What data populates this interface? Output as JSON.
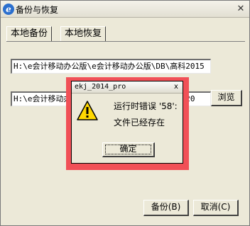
{
  "window": {
    "title": "备份与恢复",
    "app_icon": "e-logo-icon",
    "close_symbol": "✕"
  },
  "tabs": [
    {
      "label": "本地备份",
      "active": true
    },
    {
      "label": "本地恢复",
      "active": false
    }
  ],
  "backup_path": {
    "value": "H:\\e会计移动办公版\\e会计移动办公版\\DB\\高科2015"
  },
  "restore_path": {
    "value": "H:\\e会计移动办公版\\e会计移动办公版\\DB\\高科20"
  },
  "buttons": {
    "browse": "浏览",
    "backup": "备份(B)",
    "cancel": "取消(C)"
  },
  "error_dialog": {
    "title": "ekj_2014_pro",
    "close_symbol": "x",
    "icon": "warning-icon",
    "message_line1": "运行时错误 '58':",
    "message_line2": "文件已经存在",
    "ok_label": "确定",
    "highlight_color": "#f15057"
  }
}
